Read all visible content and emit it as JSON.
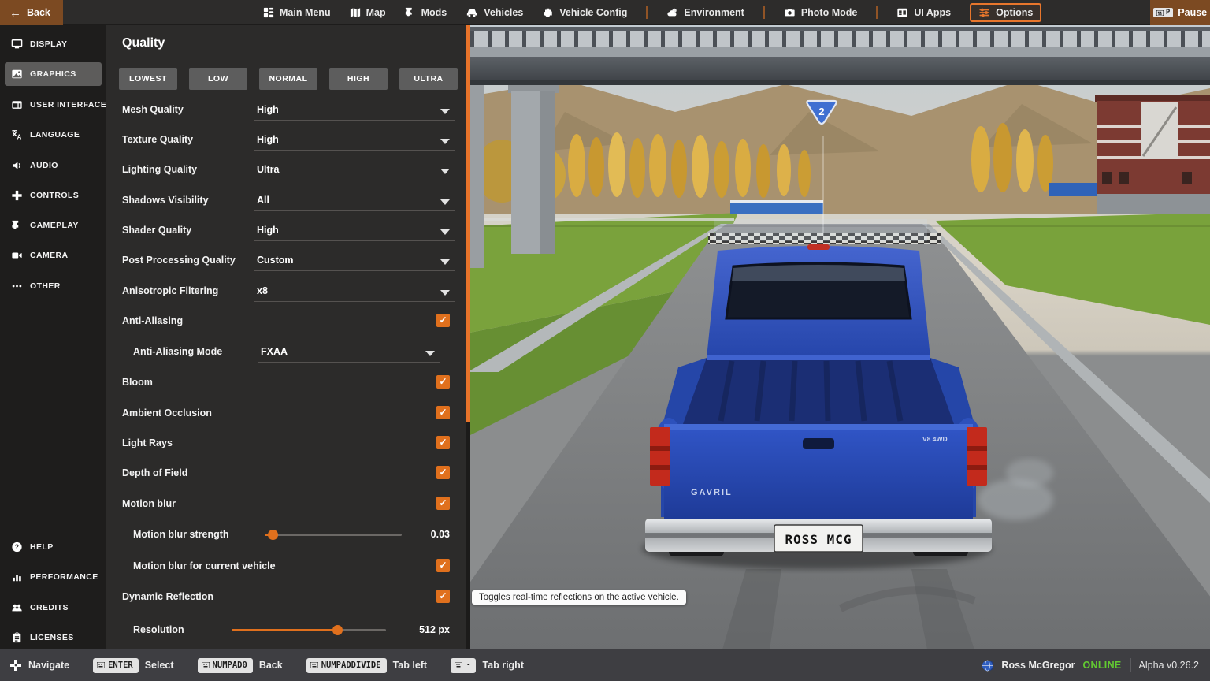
{
  "colors": {
    "accent": "#e8732a",
    "checkbox": "#e0701d",
    "online_green": "#62cb31",
    "button_brown": "#7c4a22"
  },
  "top_bar": {
    "back_label": "Back",
    "items": [
      {
        "label": "Main Menu",
        "icon": "main-menu-icon"
      },
      {
        "label": "Map",
        "icon": "map-icon"
      },
      {
        "label": "Mods",
        "icon": "mods-icon"
      },
      {
        "label": "Vehicles",
        "icon": "vehicles-icon"
      },
      {
        "label": "Vehicle Config",
        "icon": "vehicle-config-icon"
      },
      {
        "label": "Environment",
        "icon": "environment-icon"
      },
      {
        "label": "Photo Mode",
        "icon": "photo-mode-icon"
      },
      {
        "label": "UI Apps",
        "icon": "ui-apps-icon"
      },
      {
        "label": "Options",
        "icon": "options-icon"
      }
    ],
    "pause_label": "Pause",
    "pause_key": "P"
  },
  "sidebar": {
    "items": [
      {
        "label": "DISPLAY"
      },
      {
        "label": "GRAPHICS"
      },
      {
        "label": "USER INTERFACE"
      },
      {
        "label": "LANGUAGE"
      },
      {
        "label": "AUDIO"
      },
      {
        "label": "CONTROLS"
      },
      {
        "label": "GAMEPLAY"
      },
      {
        "label": "CAMERA"
      },
      {
        "label": "OTHER"
      }
    ],
    "footer_items": [
      {
        "label": "HELP"
      },
      {
        "label": "PERFORMANCE"
      },
      {
        "label": "CREDITS"
      },
      {
        "label": "LICENSES"
      }
    ]
  },
  "panel": {
    "title": "Quality",
    "presets": [
      "LOWEST",
      "LOW",
      "NORMAL",
      "HIGH",
      "ULTRA"
    ],
    "rows": [
      {
        "type": "select",
        "label": "Mesh Quality",
        "value": "High"
      },
      {
        "type": "select",
        "label": "Texture Quality",
        "value": "High"
      },
      {
        "type": "select",
        "label": "Lighting Quality",
        "value": "Ultra"
      },
      {
        "type": "select",
        "label": "Shadows Visibility",
        "value": "All"
      },
      {
        "type": "select",
        "label": "Shader Quality",
        "value": "High"
      },
      {
        "type": "select",
        "label": "Post Processing Quality",
        "value": "Custom"
      },
      {
        "type": "select",
        "label": "Anisotropic Filtering",
        "value": "x8"
      },
      {
        "type": "checkbox",
        "label": "Anti-Aliasing",
        "checked": true
      },
      {
        "type": "select",
        "label": "Anti-Aliasing Mode",
        "value": "FXAA",
        "indent": true
      },
      {
        "type": "checkbox",
        "label": "Bloom",
        "checked": true
      },
      {
        "type": "checkbox",
        "label": "Ambient Occlusion",
        "checked": true
      },
      {
        "type": "checkbox",
        "label": "Light Rays",
        "checked": true
      },
      {
        "type": "checkbox",
        "label": "Depth of Field",
        "checked": true
      },
      {
        "type": "checkbox",
        "label": "Motion blur",
        "checked": true
      },
      {
        "type": "slider",
        "label": "Motion blur strength",
        "value": "0.03",
        "indent": true
      },
      {
        "type": "checkbox",
        "label": "Motion blur for current vehicle",
        "checked": true,
        "indent": true
      },
      {
        "type": "checkbox",
        "label": "Dynamic Reflection",
        "checked": true
      },
      {
        "type": "slider",
        "label": "Resolution",
        "value": "512 px",
        "indent": true
      }
    ]
  },
  "tooltip": "Toggles real-time reflections on the active vehicle.",
  "scene": {
    "route_sign": "2",
    "license_plate": "ROSS MCG",
    "truck_badge": "GAVRIL",
    "truck_badge2": "V8 4WD"
  },
  "bottom_bar": {
    "hints": [
      {
        "label": "Navigate",
        "icon": "dpad-icon"
      },
      {
        "label": "Select",
        "key": "ENTER"
      },
      {
        "label": "Back",
        "key": "NUMPAD0"
      },
      {
        "label": "Tab left",
        "key": "NUMPADDIVIDE"
      },
      {
        "label": "Tab right",
        "key": ""
      }
    ],
    "user": {
      "name": "Ross McGregor",
      "status": "ONLINE"
    },
    "version": "Alpha v0.26.2"
  }
}
